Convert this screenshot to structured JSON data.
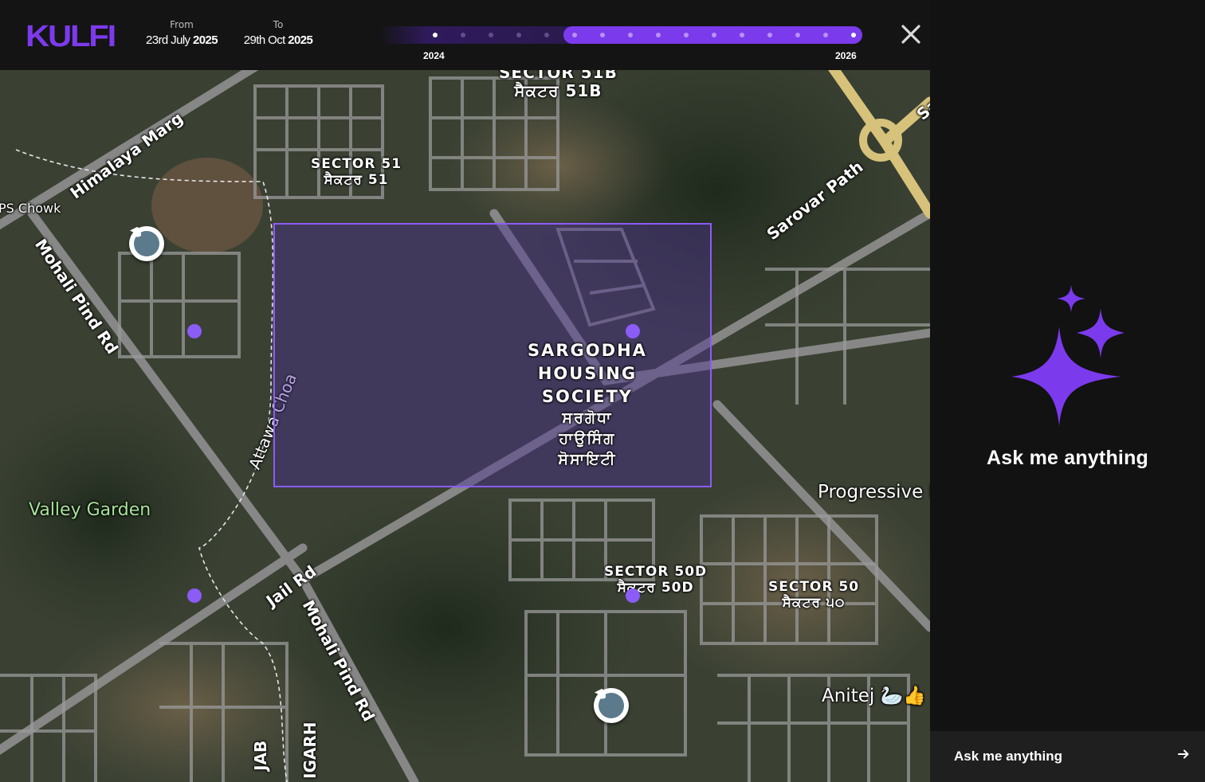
{
  "app": {
    "logo": "KULFI",
    "accent": "#7c3aed"
  },
  "date_range": {
    "from_label": "From",
    "from_value_prefix": "23rd July ",
    "from_value_year": "2025",
    "to_label": "To",
    "to_value_prefix": "29th Oct ",
    "to_value_year": "2025"
  },
  "timeline": {
    "start_year_label": "2024",
    "end_year_label": "2026",
    "total_ticks": 16,
    "selected_start_index": 5,
    "selected_end_index": 15,
    "active_dot_indices": [
      0,
      15
    ]
  },
  "close_icon": "close-icon",
  "map": {
    "labels": {
      "sector51b_en": "SECTOR 51B",
      "sector51b_pa": "ਸੈਕਟਰ 51B",
      "sector51_en": "SECTOR 51",
      "sector51_pa": "ਸੈਕਟਰ 51",
      "sargodha_1": "SARGODHA",
      "sargodha_2": "HOUSING",
      "sargodha_3": "SOCIETY",
      "sargodha_pa1": "ਸਰਗੋਧਾ",
      "sargodha_pa2": "ਹਾਉਸਿੰਗ",
      "sargodha_pa3": "ਸੋਸਾਇਟੀ",
      "sector50d_en": "SECTOR 50D",
      "sector50d_pa": "ਸੈਕਟਰ 50D",
      "sector50_en": "SECTOR 50",
      "sector50_pa": "ਸੈਕਟਰ ੫੦",
      "himalaya_marg": "Himalaya Marg",
      "ps_chowk": "PS Chowk",
      "mohali_pind_rd_1": "Mohali Pind Rd",
      "mohali_pind_rd_2": "Mohali Pind Rd",
      "attawa_choa": "Attawa Choa",
      "valley_garden": "Valley Garden",
      "jail_rd": "Jail Rd",
      "sarovar_path": "Sarovar Path",
      "progressive": "Progressive I",
      "anitej": "Anitej 🦢👍",
      "sa_partial": "Sa",
      "jab_partial": "JAB",
      "igarh_partial": "IGARH"
    },
    "pin_color": "#8b5cf6",
    "pins": 4,
    "school_markers": 2,
    "school_icon": "graduation-cap-icon"
  },
  "chat": {
    "sparkles_icon": "sparkles-icon",
    "title": "Ask me anything",
    "input_placeholder": "Ask me anything",
    "send_icon": "arrow-right-icon"
  }
}
